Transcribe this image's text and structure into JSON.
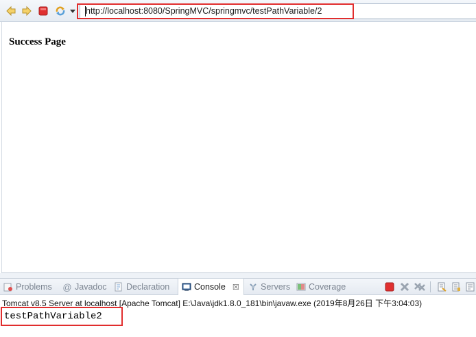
{
  "browser": {
    "url": "http://localhost:8080/SpringMVC/springmvc/testPathVariable/2"
  },
  "page": {
    "heading": "Success Page"
  },
  "views": {
    "tabs": [
      {
        "label": "Problems",
        "icon": "problems-icon"
      },
      {
        "label": "Javadoc",
        "icon": "javadoc-icon"
      },
      {
        "label": "Declaration",
        "icon": "declaration-icon"
      },
      {
        "label": "Console",
        "icon": "console-icon",
        "active": true,
        "close": "☒"
      },
      {
        "label": "Servers",
        "icon": "servers-icon"
      },
      {
        "label": "Coverage",
        "icon": "coverage-icon"
      }
    ]
  },
  "console": {
    "header": "Tomcat v8.5 Server at localhost [Apache Tomcat] E:\\Java\\jdk1.8.0_181\\bin\\javaw.exe (2019年8月26日 下午3:04:03)",
    "output": "testPathVariable2"
  },
  "colors": {
    "highlight": "#e12d2d",
    "stop_red": "#e03030",
    "nav_arrow": "#f0c040"
  }
}
